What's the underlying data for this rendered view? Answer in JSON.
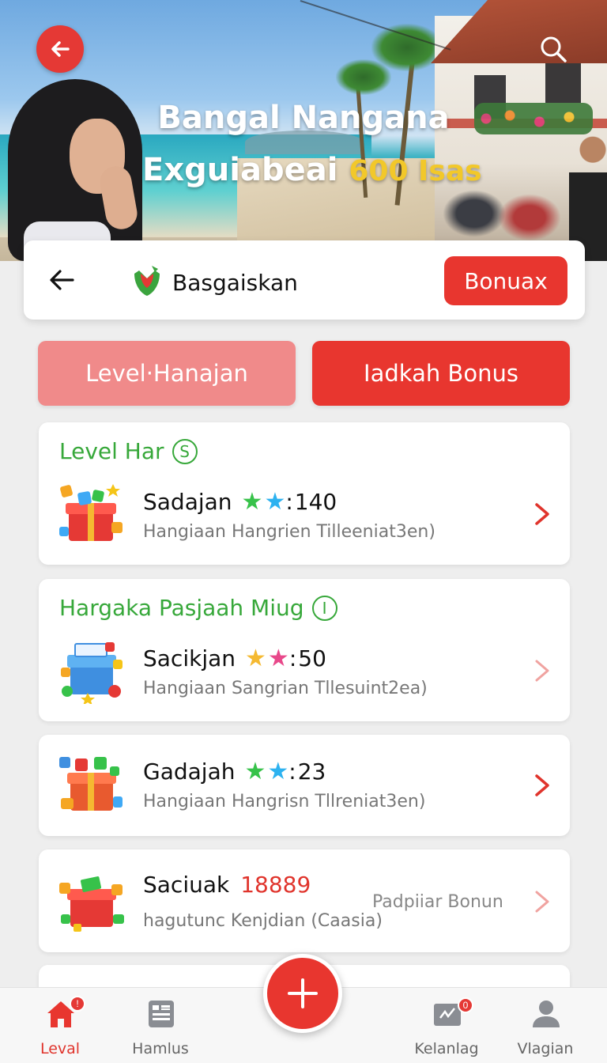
{
  "hero": {
    "title": "Bangal Nangana",
    "subtitle_main": "Exguiabeai",
    "subtitle_accent": "600 Isas"
  },
  "header": {
    "brand": "Basgaiskan",
    "bonus_button": "Bonuax"
  },
  "tabs": [
    {
      "label": "Level·Hanajan",
      "active": false
    },
    {
      "label": "Iadkah Bonus",
      "active": true
    }
  ],
  "cards": [
    {
      "section": "Level Har",
      "section_badge": "S",
      "name": "Sadajan",
      "stars": [
        "green-star",
        "blue-star"
      ],
      "separator": ":",
      "value": "140",
      "description": "Hangiaan Hangrien Tilleeniat3en)"
    },
    {
      "section": "Hargaka Pasjaah Miug",
      "section_badge": "I",
      "name": "Sacikjan",
      "stars": [
        "gold-star",
        "pink-star"
      ],
      "separator": ":",
      "value": "50",
      "description": "Hangiaan Sangrian Tllesuint2ea)"
    },
    {
      "name": "Gadajah",
      "stars": [
        "green-star",
        "blue-star"
      ],
      "separator": ":",
      "value": "23",
      "description": "Hangiaan Hangrisn Tllreniat3en)"
    },
    {
      "name": "Saciuak",
      "value": "18889",
      "side_text": "Padpiiar Bonun",
      "description": "hagutunc Kenjdian (Caasia)"
    }
  ],
  "nav": [
    {
      "label": "Leval",
      "active": true,
      "badge": "!"
    },
    {
      "label": "Hamlus",
      "active": false
    },
    {
      "label": "Kelanlag",
      "active": false,
      "badge": "0"
    },
    {
      "label": "Vlagian",
      "active": false
    }
  ],
  "colors": {
    "primary_red": "#e8362f",
    "light_red": "#f08a8a",
    "green": "#37a83a",
    "background": "#eeeeee"
  }
}
